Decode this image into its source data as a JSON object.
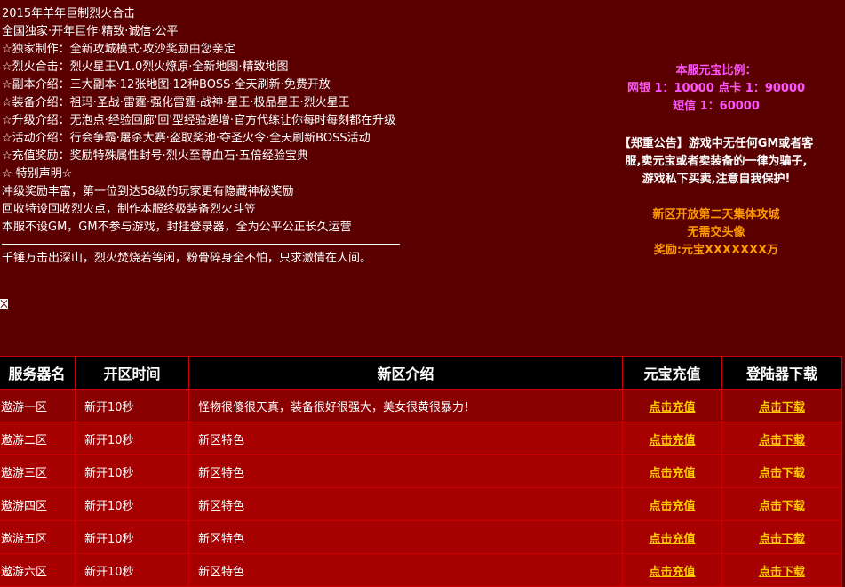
{
  "intro": {
    "lines": [
      "2015年羊年巨制烈火合击",
      "全国独家·开年巨作·精致·诚信·公平",
      "☆独家制作：全新攻城模式·攻沙奖励由您亲定",
      "☆烈火合击：烈火星王V1.0烈火燎原·全新地图·精致地图",
      "☆副本介绍：三大副本·12张地图·12种BOSS·全天刷新·免费开放",
      "☆装备介绍：祖玛·圣战·雷霆·强化雷霆·战神·星王·极品星王·烈火星王",
      "☆升级介绍：无泡点·经验回廊'回'型经验递增·官方代练让你每时每刻都在升级",
      "☆活动介绍：行会争霸·屠杀大赛·盗取奖池·夺圣火令·全天刷新BOSS活动",
      "☆充值奖励：奖励特殊属性封号·烈火至尊血石·五倍经验宝典",
      "☆ 特别声明☆",
      "冲级奖励丰富，第一位到达58级的玩家更有隐藏神秘奖励",
      "回收特设回收烈火点，制作本服终极装备烈火斗笠",
      "本服不设GM，GM不参与游戏，封挂登录器，全为公平公正长久运营"
    ],
    "poem": "千锤万击出深山，烈火焚烧若等闲，粉骨碎身全不怕，只求激情在人间。"
  },
  "right_panel": {
    "ratio_title": "本服元宝比例：",
    "ratio_line1": "网银 1：10000 点卡 1：90000",
    "ratio_line2": "短信 1：60000",
    "notice_line1": "【郑重公告】游戏中无任何GM或者客",
    "notice_line2": "服,卖元宝或者卖装备的一律为骗子,",
    "notice_line3": "游戏私下买卖,注意自我保护!",
    "event_line1": "新区开放第二天集体攻城",
    "event_line2": "无需交头像",
    "event_line3": "奖励:元宝XXXXXXX万"
  },
  "table": {
    "headers": [
      "服务器名",
      "开区时间",
      "新区介绍",
      "元宝充值",
      "登陆器下载"
    ],
    "rows": [
      {
        "name": "遨游一区",
        "time": "新开10秒",
        "desc": "怪物很傻很天真，装备很好很强大，美女很黄很暴力！",
        "recharge": "点击充值",
        "download": "点击下载"
      },
      {
        "name": "遨游二区",
        "time": "新开10秒",
        "desc": "新区特色",
        "recharge": "点击充值",
        "download": "点击下载"
      },
      {
        "name": "遨游三区",
        "time": "新开10秒",
        "desc": "新区特色",
        "recharge": "点击充值",
        "download": "点击下载"
      },
      {
        "name": "遨游四区",
        "time": "新开10秒",
        "desc": "新区特色",
        "recharge": "点击充值",
        "download": "点击下载"
      },
      {
        "name": "遨游五区",
        "time": "新开10秒",
        "desc": "新区特色",
        "recharge": "点击充值",
        "download": "点击下载"
      },
      {
        "name": "遨游六区",
        "time": "新开10秒",
        "desc": "新区特色",
        "recharge": "点击充值",
        "download": "点击下载"
      }
    ]
  },
  "colors": {
    "page_bg": "#5a0000",
    "row_dark": "#8b0000",
    "row_bright": "#a60000",
    "link": "#ffcc00",
    "ratio": "#ff55ff",
    "event": "#ff9900"
  }
}
